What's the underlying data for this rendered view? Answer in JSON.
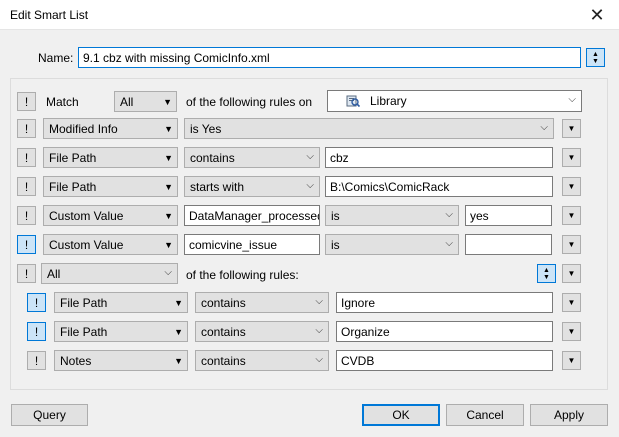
{
  "window": {
    "title": "Edit Smart List"
  },
  "name": {
    "label": "Name:",
    "value": "9.1 cbz with missing ComicInfo.xml"
  },
  "match": {
    "label": "Match",
    "mode": "All",
    "rules_on_label": "of the following rules on",
    "source": "Library"
  },
  "rules": [
    {
      "field": "Modified Info",
      "op": "is Yes"
    },
    {
      "field": "File Path",
      "op": "contains",
      "value": "cbz"
    },
    {
      "field": "File Path",
      "op": "starts with",
      "value": "B:\\Comics\\ComicRack"
    },
    {
      "field": "Custom Value",
      "key": "DataManager_processed",
      "op": "is",
      "value": "yes"
    },
    {
      "field": "Custom Value",
      "key": "comicvine_issue",
      "op": "is",
      "value": ""
    }
  ],
  "group": {
    "mode": "All",
    "label": "of the following rules:",
    "rules": [
      {
        "field": "File Path",
        "op": "contains",
        "value": "Ignore"
      },
      {
        "field": "File Path",
        "op": "contains",
        "value": "Organize"
      },
      {
        "field": "Notes",
        "op": "contains",
        "value": "CVDB"
      }
    ]
  },
  "buttons": {
    "query": "Query",
    "ok": "OK",
    "cancel": "Cancel",
    "apply": "Apply"
  },
  "glyphs": {
    "not": "!",
    "dropdown": "▼",
    "chevron": "⌵",
    "close": "✕",
    "up": "▲",
    "down": "▼"
  },
  "colors": {
    "accent": "#0078d7",
    "button_bg": "#e1e1e1",
    "toggle_on_bg": "#cce4f7"
  }
}
